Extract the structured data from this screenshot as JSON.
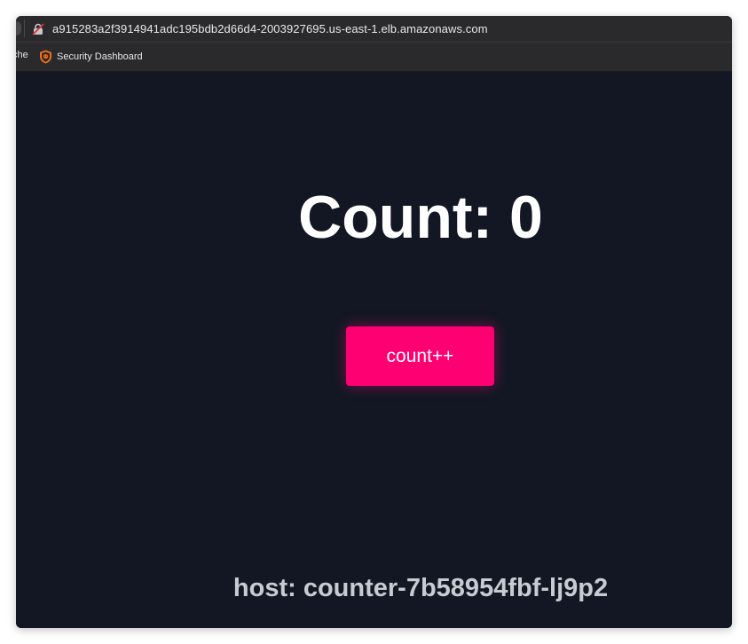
{
  "browser": {
    "url": "a915283a2f3914941adc195bdb2d66d4-2003927695.us-east-1.elb.amazonaws.com",
    "lock_icon": "insecure-lock-icon",
    "bookmarks": {
      "partial_label": "che",
      "items": [
        {
          "label": "Security Dashboard",
          "icon": "shield-icon"
        }
      ]
    }
  },
  "page": {
    "count_title": "Count: 0",
    "button_label": "count++",
    "host_text": "host: counter-7b58954fbf-lj9p2"
  },
  "colors": {
    "background": "#121723",
    "button": "#ff0073",
    "host_text": "#c8ccd2"
  }
}
